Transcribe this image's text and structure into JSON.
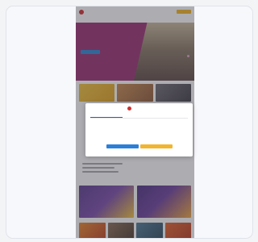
{
  "site": {
    "logo_text": "",
    "nav_cta": "",
    "nav_items": [
      "",
      "",
      "",
      "",
      "",
      ""
    ]
  },
  "hero": {
    "title": "",
    "button": ""
  },
  "consent": {
    "tabs": [
      "",
      "",
      ""
    ],
    "title": "",
    "body": "",
    "link": "",
    "deny_label": "",
    "allow_label": ""
  },
  "colors": {
    "hero_bg": "#9a2f73",
    "brand_red": "#d12f2f",
    "cta_yellow": "#f1b321",
    "button_blue": "#2c87d6"
  },
  "icons": [
    "logo-mark-icon"
  ]
}
